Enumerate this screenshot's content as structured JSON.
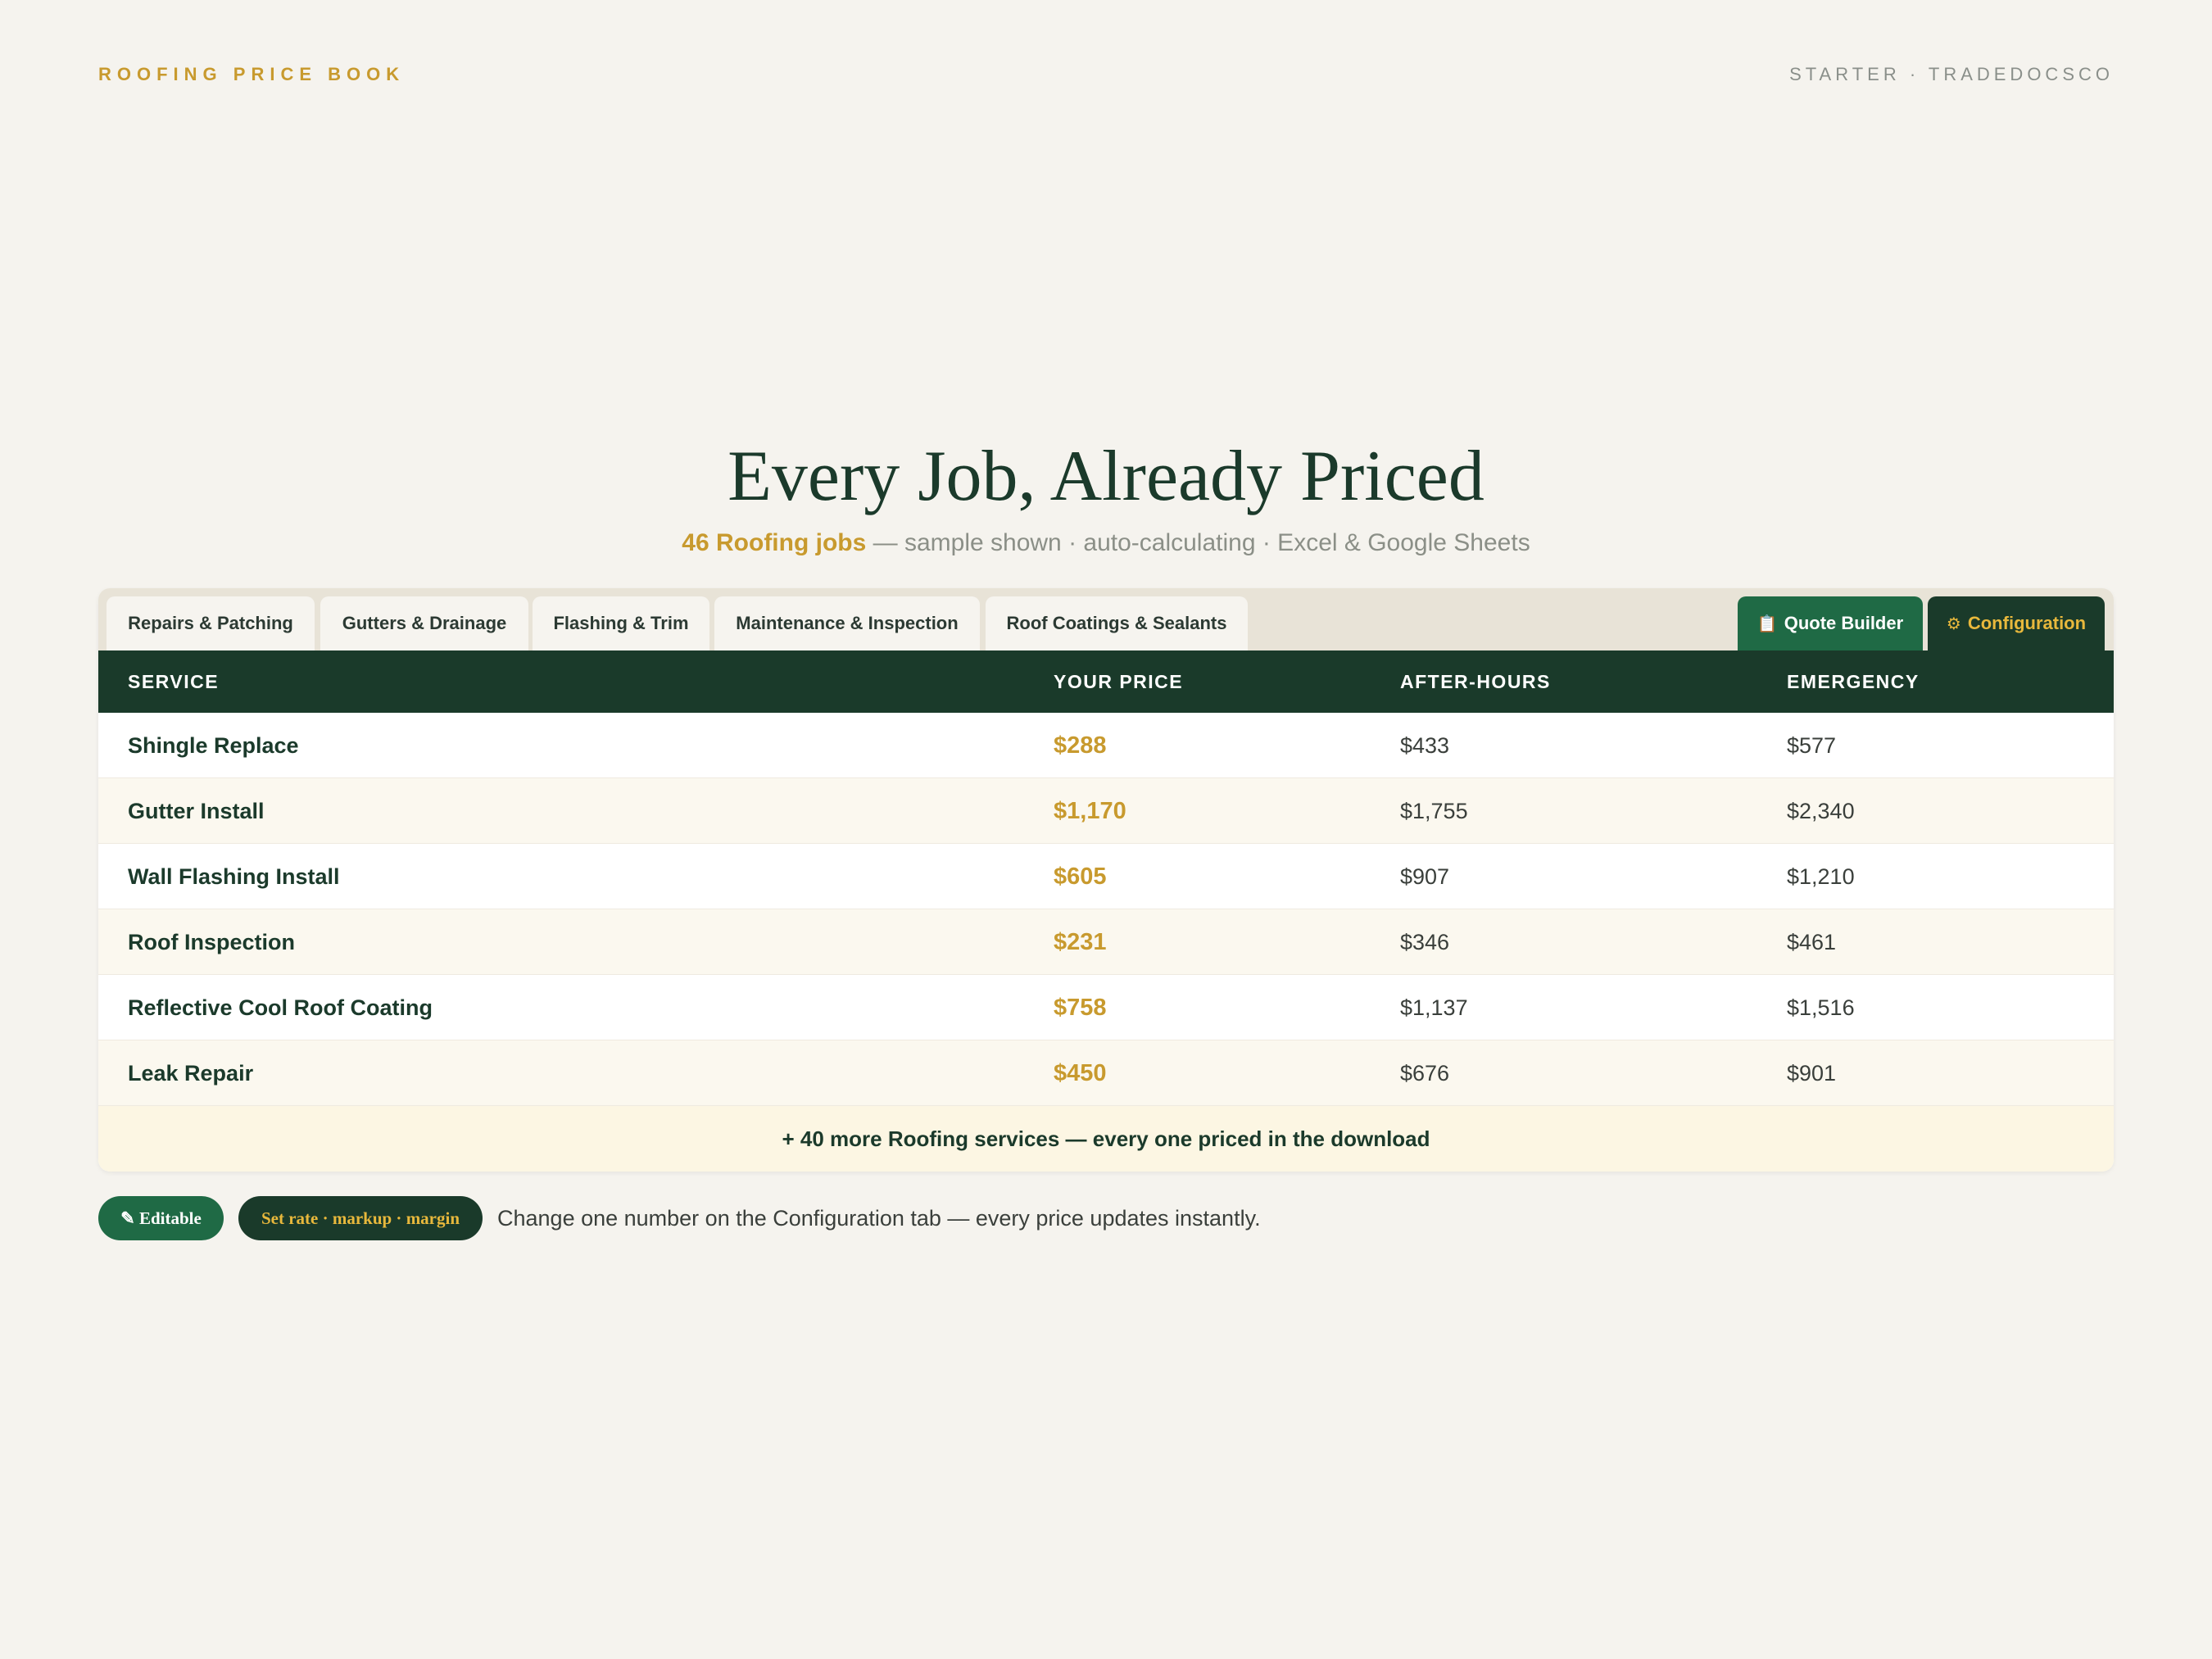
{
  "header": {
    "brand": "ROOFING PRICE BOOK",
    "edition": "STARTER · TRADEDOCSCO"
  },
  "hero": {
    "title": "Every Job, Already Priced",
    "count_text": "46 Roofing jobs",
    "sub_text": " — sample shown · auto-calculating · Excel & Google Sheets"
  },
  "tabs": [
    {
      "label": "Repairs & Patching"
    },
    {
      "label": "Gutters & Drainage"
    },
    {
      "label": "Flashing & Trim"
    },
    {
      "label": "Maintenance & Inspection"
    },
    {
      "label": "Roof Coatings & Sealants"
    }
  ],
  "actions": {
    "quote_icon": "📋",
    "quote_label": "Quote Builder",
    "config_icon": "⚙",
    "config_label": "Configuration"
  },
  "table": {
    "columns": [
      "SERVICE",
      "YOUR PRICE",
      "AFTER-HOURS",
      "EMERGENCY"
    ],
    "rows": [
      {
        "service": "Shingle Replace",
        "price": "$288",
        "after_hours": "$433",
        "emergency": "$577"
      },
      {
        "service": "Gutter Install",
        "price": "$1,170",
        "after_hours": "$1,755",
        "emergency": "$2,340"
      },
      {
        "service": "Wall Flashing Install",
        "price": "$605",
        "after_hours": "$907",
        "emergency": "$1,210"
      },
      {
        "service": "Roof Inspection",
        "price": "$231",
        "after_hours": "$346",
        "emergency": "$461"
      },
      {
        "service": "Reflective Cool Roof Coating",
        "price": "$758",
        "after_hours": "$1,137",
        "emergency": "$1,516"
      },
      {
        "service": "Leak Repair",
        "price": "$450",
        "after_hours": "$676",
        "emergency": "$901"
      }
    ],
    "more": "+ 40 more Roofing services — every one priced in the download"
  },
  "footer": {
    "editable_label": "✎ Editable",
    "set_label": "Set rate · markup · margin",
    "note": "Change one number on the Configuration tab — every price updates instantly."
  },
  "colors": {
    "accent_gold": "#c89a2e",
    "dark_green": "#1a3a2a",
    "green": "#1f6a45",
    "background": "#f5f3ee"
  }
}
